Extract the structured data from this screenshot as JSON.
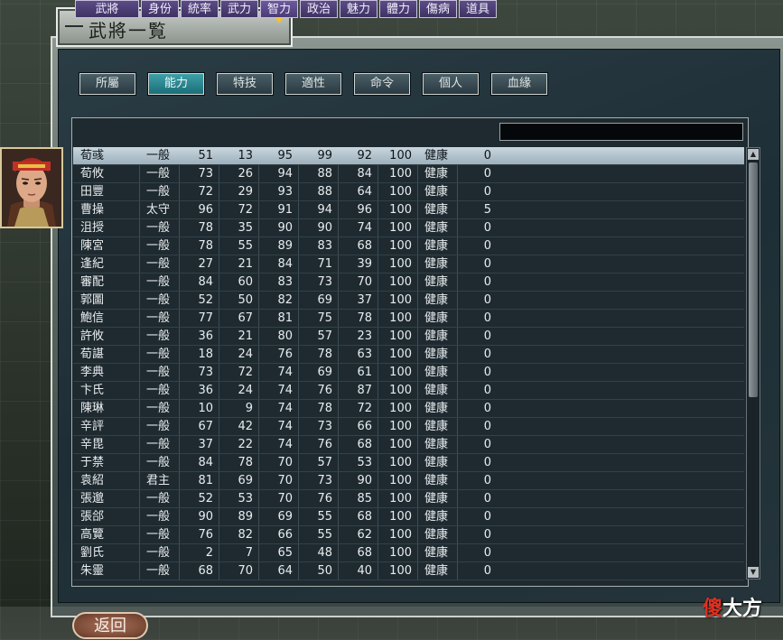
{
  "window": {
    "title": "武將一覧"
  },
  "tabs": [
    {
      "label": "所屬",
      "active": false
    },
    {
      "label": "能力",
      "active": true
    },
    {
      "label": "特技",
      "active": false
    },
    {
      "label": "適性",
      "active": false
    },
    {
      "label": "命令",
      "active": false
    },
    {
      "label": "個人",
      "active": false
    },
    {
      "label": "血緣",
      "active": false
    }
  ],
  "table": {
    "headers": [
      "武將",
      "身份",
      "統率",
      "武力",
      "智力",
      "政治",
      "魅力",
      "體力",
      "傷病",
      "道具"
    ],
    "sorted_column": "智力",
    "selected_row": 0,
    "rows": [
      [
        "荀彧",
        "一般",
        "51",
        "13",
        "95",
        "99",
        "92",
        "100",
        "健康",
        "0"
      ],
      [
        "荀攸",
        "一般",
        "73",
        "26",
        "94",
        "88",
        "84",
        "100",
        "健康",
        "0"
      ],
      [
        "田豐",
        "一般",
        "72",
        "29",
        "93",
        "88",
        "64",
        "100",
        "健康",
        "0"
      ],
      [
        "曹操",
        "太守",
        "96",
        "72",
        "91",
        "94",
        "96",
        "100",
        "健康",
        "5"
      ],
      [
        "沮授",
        "一般",
        "78",
        "35",
        "90",
        "90",
        "74",
        "100",
        "健康",
        "0"
      ],
      [
        "陳宮",
        "一般",
        "78",
        "55",
        "89",
        "83",
        "68",
        "100",
        "健康",
        "0"
      ],
      [
        "逢紀",
        "一般",
        "27",
        "21",
        "84",
        "71",
        "39",
        "100",
        "健康",
        "0"
      ],
      [
        "審配",
        "一般",
        "84",
        "60",
        "83",
        "73",
        "70",
        "100",
        "健康",
        "0"
      ],
      [
        "郭圖",
        "一般",
        "52",
        "50",
        "82",
        "69",
        "37",
        "100",
        "健康",
        "0"
      ],
      [
        "鮑信",
        "一般",
        "77",
        "67",
        "81",
        "75",
        "78",
        "100",
        "健康",
        "0"
      ],
      [
        "許攸",
        "一般",
        "36",
        "21",
        "80",
        "57",
        "23",
        "100",
        "健康",
        "0"
      ],
      [
        "荀諶",
        "一般",
        "18",
        "24",
        "76",
        "78",
        "63",
        "100",
        "健康",
        "0"
      ],
      [
        "李典",
        "一般",
        "73",
        "72",
        "74",
        "69",
        "61",
        "100",
        "健康",
        "0"
      ],
      [
        "卞氏",
        "一般",
        "36",
        "24",
        "74",
        "76",
        "87",
        "100",
        "健康",
        "0"
      ],
      [
        "陳琳",
        "一般",
        "10",
        "9",
        "74",
        "78",
        "72",
        "100",
        "健康",
        "0"
      ],
      [
        "辛評",
        "一般",
        "67",
        "42",
        "74",
        "73",
        "66",
        "100",
        "健康",
        "0"
      ],
      [
        "辛毘",
        "一般",
        "37",
        "22",
        "74",
        "76",
        "68",
        "100",
        "健康",
        "0"
      ],
      [
        "于禁",
        "一般",
        "84",
        "78",
        "70",
        "57",
        "53",
        "100",
        "健康",
        "0"
      ],
      [
        "袁紹",
        "君主",
        "81",
        "69",
        "70",
        "73",
        "90",
        "100",
        "健康",
        "0"
      ],
      [
        "張邈",
        "一般",
        "52",
        "53",
        "70",
        "76",
        "85",
        "100",
        "健康",
        "0"
      ],
      [
        "張郃",
        "一般",
        "90",
        "89",
        "69",
        "55",
        "68",
        "100",
        "健康",
        "0"
      ],
      [
        "高覽",
        "一般",
        "76",
        "82",
        "66",
        "55",
        "62",
        "100",
        "健康",
        "0"
      ],
      [
        "劉氏",
        "一般",
        "2",
        "7",
        "65",
        "48",
        "68",
        "100",
        "健康",
        "0"
      ],
      [
        "朱靈",
        "一般",
        "68",
        "70",
        "64",
        "50",
        "40",
        "100",
        "健康",
        "0"
      ]
    ]
  },
  "buttons": {
    "back": "返回"
  },
  "watermark": {
    "first": "傻",
    "rest": "大方"
  },
  "icons": {
    "sort_indicator": "triangle-down-icon",
    "scroll_up": "chevron-up-icon",
    "scroll_down": "chevron-down-icon"
  }
}
